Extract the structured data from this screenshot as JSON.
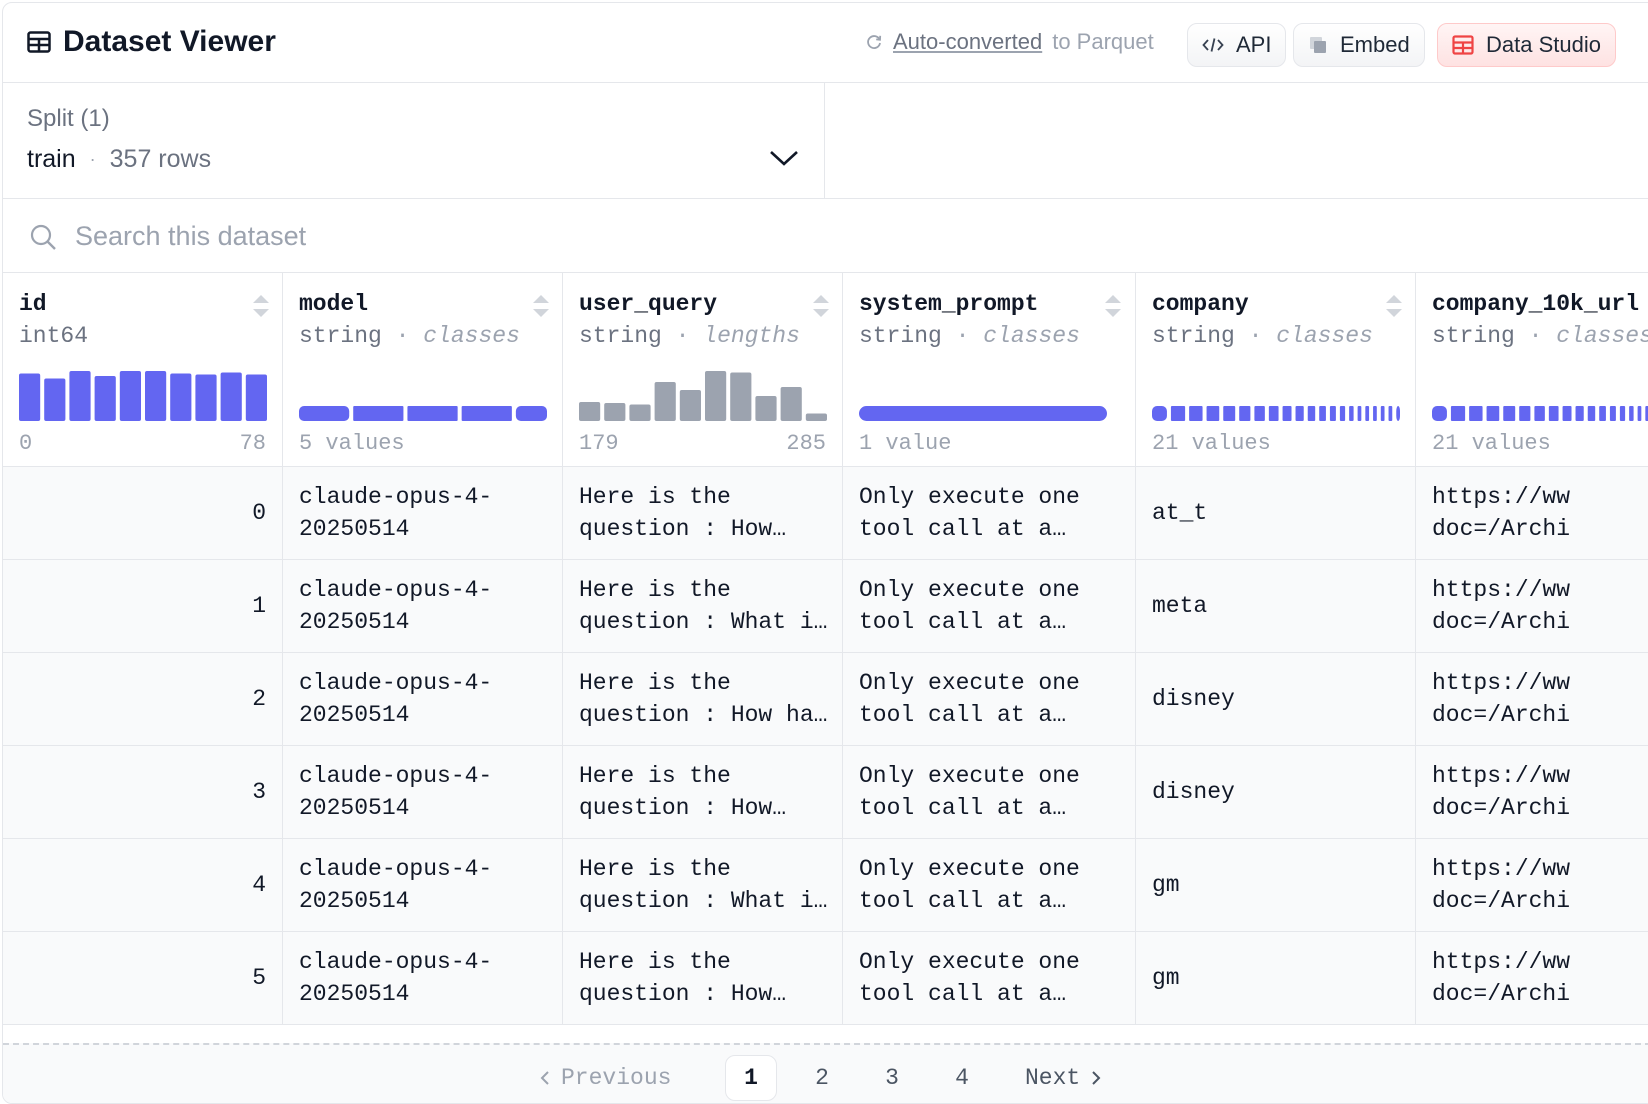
{
  "header": {
    "title": "Dataset Viewer",
    "parquet_link": "Auto-converted",
    "parquet_suffix": "to Parquet",
    "api_label": "API",
    "embed_label": "Embed",
    "studio_label": "Data Studio"
  },
  "split": {
    "label": "Split (1)",
    "name": "train",
    "separator": "·",
    "rows": "357 rows"
  },
  "search": {
    "placeholder": "Search this dataset"
  },
  "columns": [
    {
      "name": "id",
      "type": "int64",
      "kind": "",
      "stat_left": "0",
      "stat_right": "78",
      "histogram": [
        0.95,
        0.85,
        1.0,
        0.9,
        1.0,
        1.0,
        0.95,
        0.93,
        0.97,
        0.93
      ]
    },
    {
      "name": "model",
      "type": "string",
      "kind": "classes",
      "stat_left": "5 values",
      "stat_right": "",
      "classes": [
        1,
        1,
        1,
        1,
        0.62
      ]
    },
    {
      "name": "user_query",
      "type": "string",
      "kind": "lengths",
      "stat_left": "179",
      "stat_right": "285",
      "histogram": [
        0.38,
        0.36,
        0.33,
        0.78,
        0.62,
        1.0,
        0.97,
        0.5,
        0.68,
        0.15
      ]
    },
    {
      "name": "system_prompt",
      "type": "string",
      "kind": "classes",
      "stat_left": "1 value",
      "stat_right": ""
    },
    {
      "name": "company",
      "type": "string",
      "kind": "classes",
      "stat_left": "21 values",
      "stat_right": ""
    },
    {
      "name": "company_10k_url",
      "type": "string",
      "kind": "classes",
      "stat_left": "21 values",
      "stat_right": ""
    }
  ],
  "separator": "·",
  "rows": [
    {
      "id": "0",
      "model": "claude-opus-4-\n20250514",
      "user_query": "Here is the\nquestion : How…",
      "system_prompt": "Only execute one\ntool call at a…",
      "company": "at_t",
      "url": "https://ww\ndoc=/Archi"
    },
    {
      "id": "1",
      "model": "claude-opus-4-\n20250514",
      "user_query": "Here is the\nquestion : What i…",
      "system_prompt": "Only execute one\ntool call at a…",
      "company": "meta",
      "url": "https://ww\ndoc=/Archi"
    },
    {
      "id": "2",
      "model": "claude-opus-4-\n20250514",
      "user_query": "Here is the\nquestion : How ha…",
      "system_prompt": "Only execute one\ntool call at a…",
      "company": "disney",
      "url": "https://ww\ndoc=/Archi"
    },
    {
      "id": "3",
      "model": "claude-opus-4-\n20250514",
      "user_query": "Here is the\nquestion : How…",
      "system_prompt": "Only execute one\ntool call at a…",
      "company": "disney",
      "url": "https://ww\ndoc=/Archi"
    },
    {
      "id": "4",
      "model": "claude-opus-4-\n20250514",
      "user_query": "Here is the\nquestion : What i…",
      "system_prompt": "Only execute one\ntool call at a…",
      "company": "gm",
      "url": "https://ww\ndoc=/Archi"
    },
    {
      "id": "5",
      "model": "claude-opus-4-\n20250514",
      "user_query": "Here is the\nquestion : How…",
      "system_prompt": "Only execute one\ntool call at a…",
      "company": "gm",
      "url": "https://ww\ndoc=/Archi"
    }
  ],
  "pager": {
    "previous": "Previous",
    "pages": [
      "1",
      "2",
      "3",
      "4"
    ],
    "current": "1",
    "next": "Next"
  },
  "colors": {
    "accent": "#6366f1",
    "histogram_gray": "#9ca3af",
    "studio_red": "#ef4444"
  }
}
